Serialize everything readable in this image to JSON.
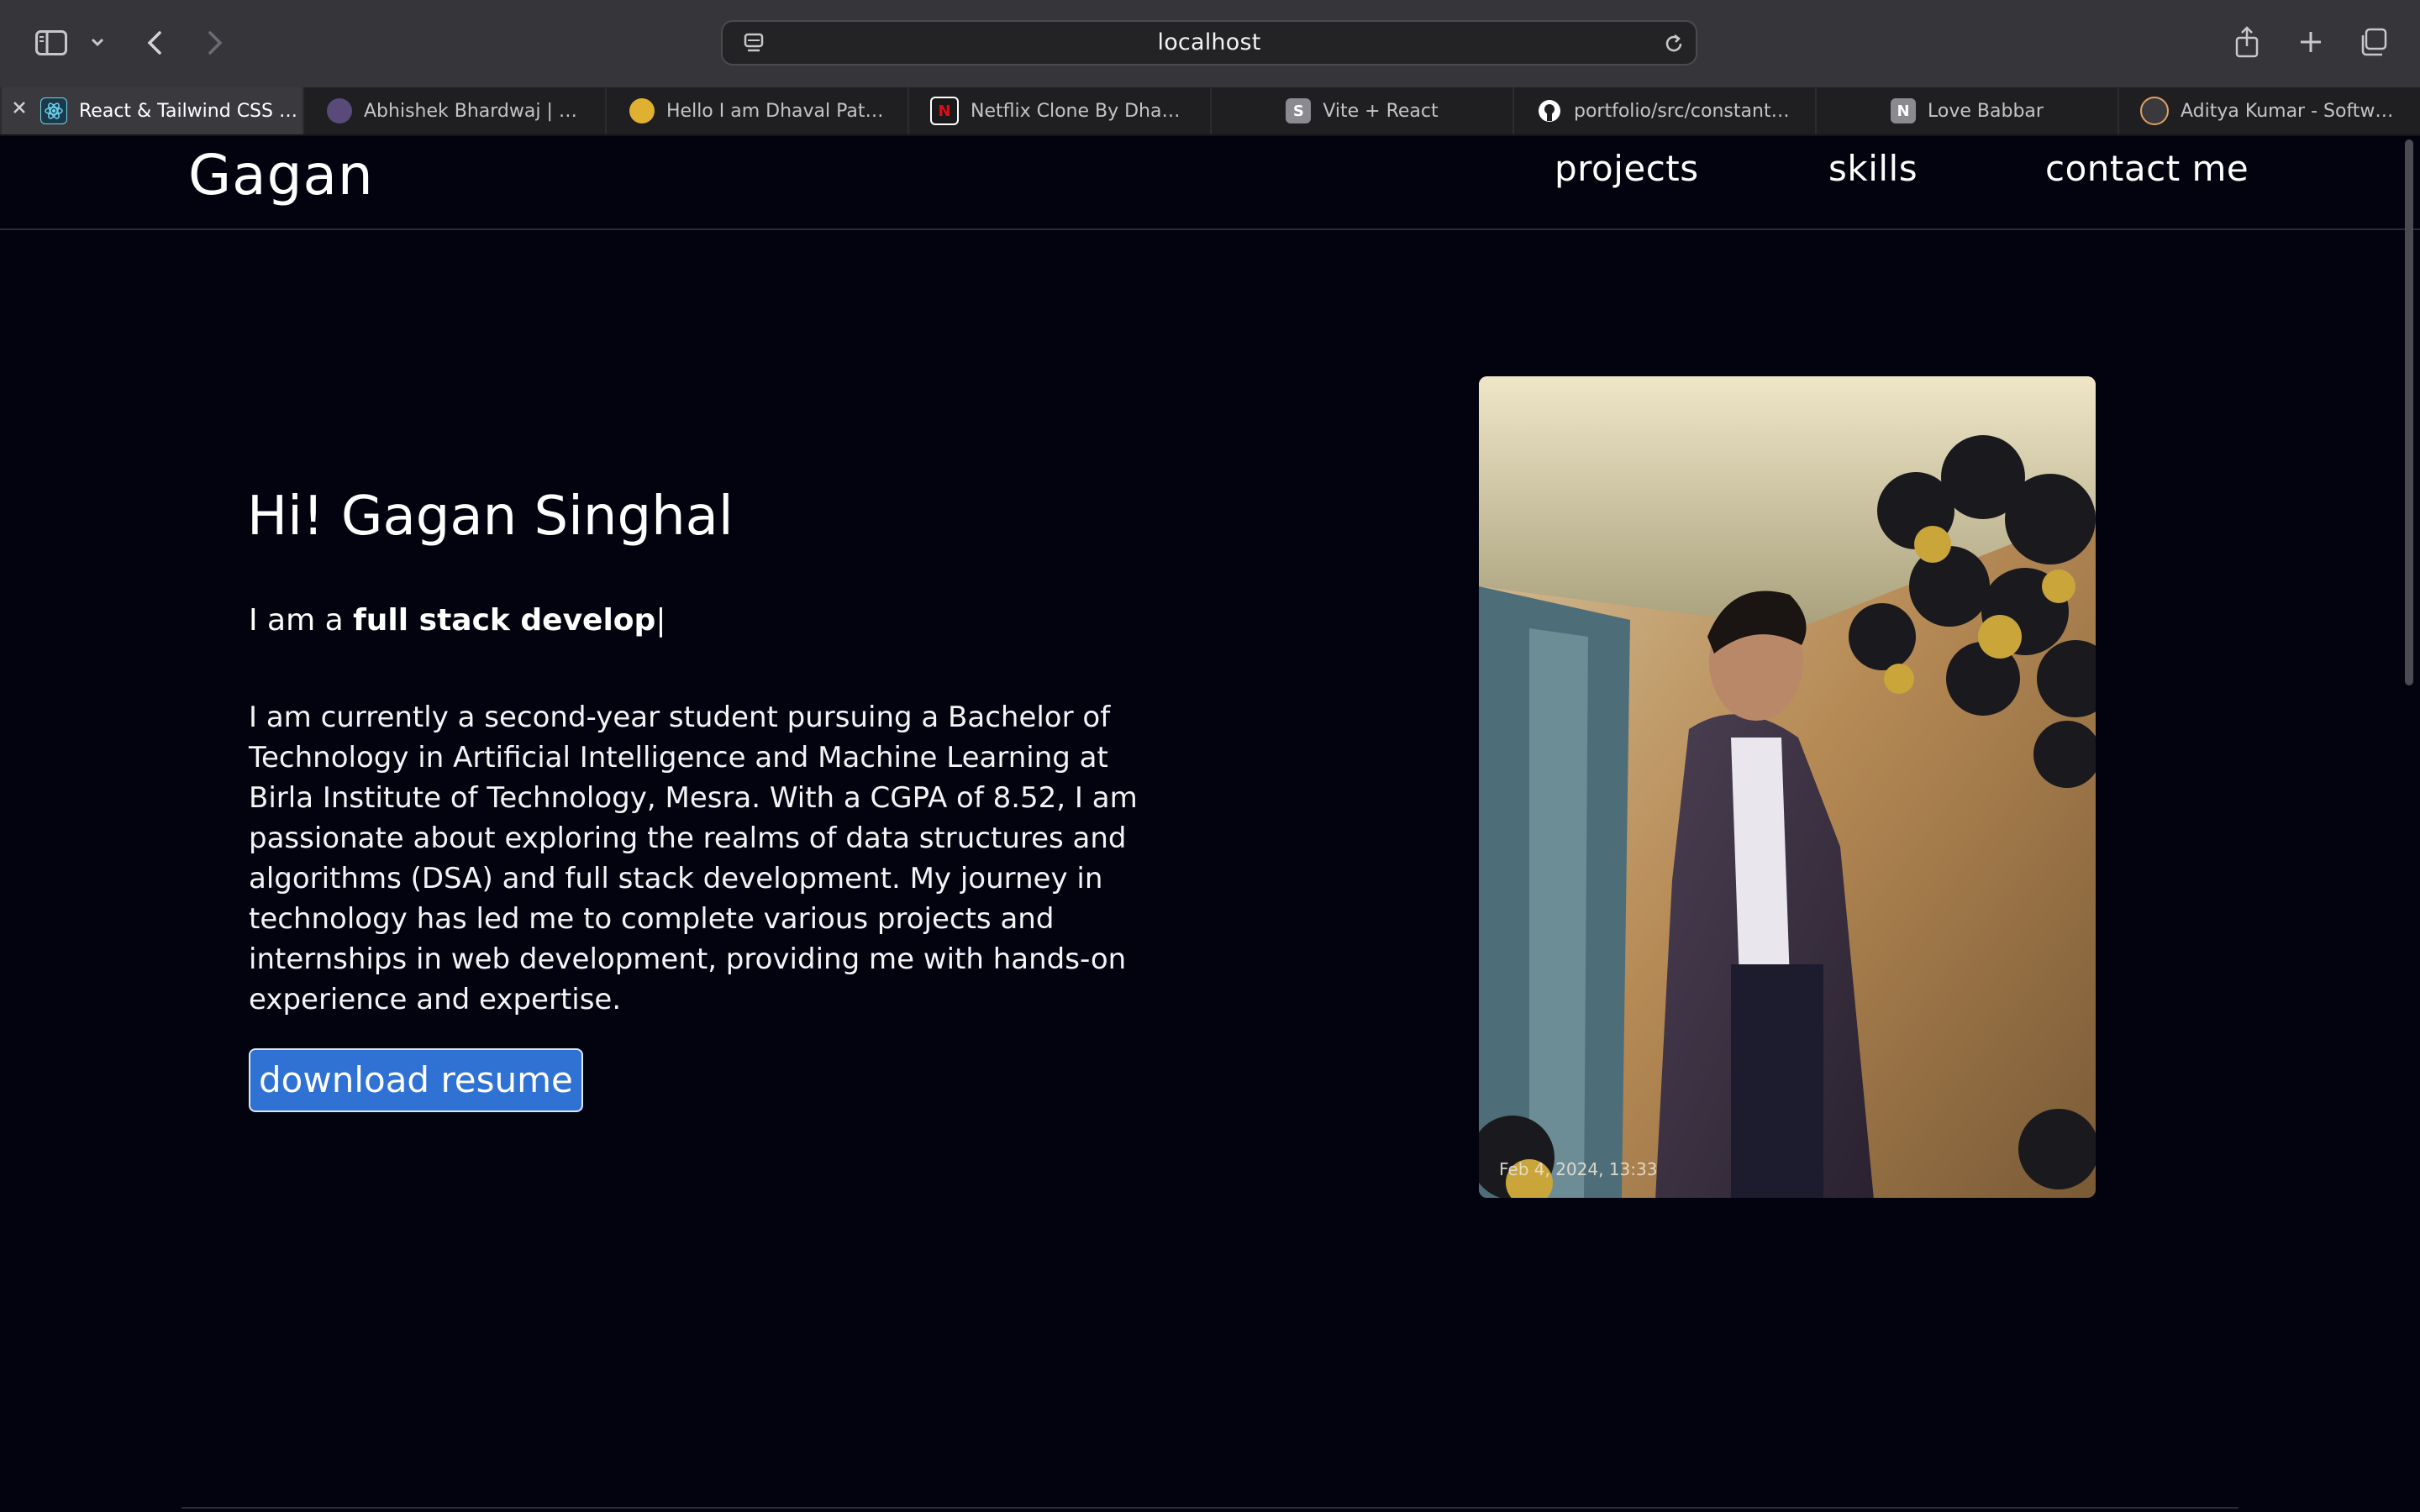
{
  "browser": {
    "url": "localhost",
    "tabs": [
      {
        "title": "React & Tailwind CSS S...",
        "favicon": "react-icon",
        "active": true
      },
      {
        "title": "Abhishek Bhardwaj | R...",
        "favicon": "avatar-icon"
      },
      {
        "title": "Hello I am Dhaval Patel...",
        "favicon": "avatar-icon"
      },
      {
        "title": "Netflix Clone By Dhava...",
        "favicon": "N"
      },
      {
        "title": "Vite + React",
        "favicon": "S"
      },
      {
        "title": "portfolio/src/constants...",
        "favicon": "github-icon"
      },
      {
        "title": "Love Babbar",
        "favicon": "N"
      },
      {
        "title": "Aditya Kumar - Softwar...",
        "favicon": "avatar-icon"
      }
    ]
  },
  "nav": {
    "logo": "Gagan",
    "links": [
      "projects",
      "skills",
      "contact me"
    ]
  },
  "hero": {
    "greeting": "Hi! Gagan Singhal",
    "tagline_prefix": "I am a ",
    "tagline_role": "full stack develop",
    "cursor": "|",
    "bio": "I am currently a second-year student pursuing a Bachelor of Technology in Artificial Intelligence and Machine Learning at Birla Institute of Technology, Mesra. With a CGPA of 8.52, I am passionate about exploring the realms of data structures and algorithms (DSA) and full stack development. My journey in technology has led me to complete various projects and internships in web development, providing me with hands-on experience and expertise.",
    "button_label": "download resume",
    "photo_timestamp": "Feb 4, 2024, 13:33"
  },
  "colors": {
    "page_bg": "#02030f",
    "button_bg": "#2f72d4",
    "chrome_bg": "#36363a",
    "tabstrip_bg": "#1f1f22"
  }
}
